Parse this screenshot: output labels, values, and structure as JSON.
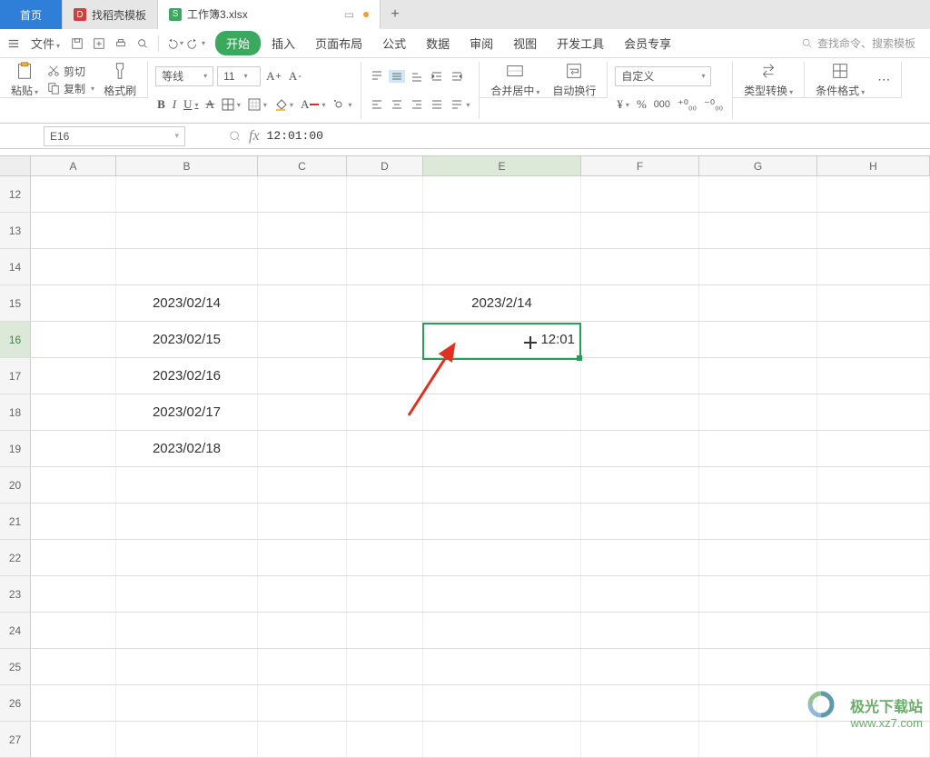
{
  "tabs": {
    "home": "首页",
    "template": "找稻壳模板",
    "file": "工作簿3.xlsx"
  },
  "menu": {
    "file": "文件",
    "items": [
      "开始",
      "插入",
      "页面布局",
      "公式",
      "数据",
      "审阅",
      "视图",
      "开发工具",
      "会员专享"
    ],
    "search_placeholder": "查找命令、搜索模板"
  },
  "ribbon": {
    "paste": "粘贴",
    "cut": "剪切",
    "copy": "复制",
    "format_painter": "格式刷",
    "font_name": "等线",
    "font_size": "11",
    "merge": "合并居中",
    "wrap": "自动换行",
    "num_format": "自定义",
    "type_convert": "类型转换",
    "cond_format": "条件格式"
  },
  "formula": {
    "cell_ref": "E16",
    "value": "12:01:00"
  },
  "cols": [
    "A",
    "B",
    "C",
    "D",
    "E",
    "F",
    "G",
    "H"
  ],
  "rownums": [
    "12",
    "13",
    "14",
    "15",
    "16",
    "17",
    "18",
    "19",
    "20",
    "21",
    "22",
    "23",
    "24",
    "25",
    "26",
    "27"
  ],
  "cells": {
    "B15": "2023/02/14",
    "B16": "2023/02/15",
    "B17": "2023/02/16",
    "B18": "2023/02/17",
    "B19": "2023/02/18",
    "E15": "2023/2/14",
    "E16": "12:01"
  },
  "watermark": {
    "text": "极光下载站",
    "url": "www.xz7.com"
  }
}
